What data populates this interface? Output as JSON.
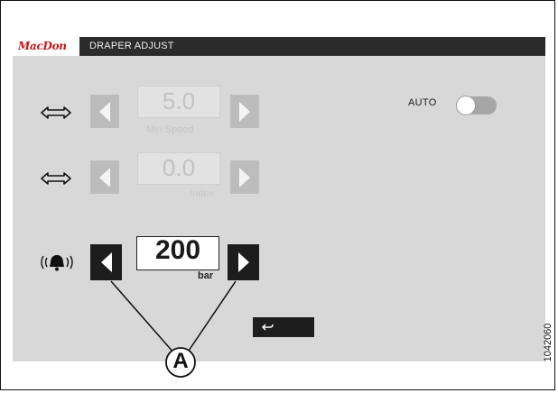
{
  "header": {
    "logo_text": "MacDon",
    "title": "DRAPER ADJUST"
  },
  "rows": [
    {
      "icon": "draper-speed-icon",
      "value": "5.0",
      "unit": "Min Speed",
      "state": "disabled"
    },
    {
      "icon": "draper-speed-icon",
      "value": "0.0",
      "unit": "Index",
      "state": "disabled"
    },
    {
      "icon": "alarm-bell-icon",
      "value": "200",
      "unit": "bar",
      "state": "active"
    }
  ],
  "auto": {
    "label": "AUTO",
    "enabled": false
  },
  "footer": {
    "back_icon": "back-arrow-icon"
  },
  "annotation": {
    "callout_letter": "A",
    "figure_number": "1042060"
  },
  "colors": {
    "brand_red": "#c4161c",
    "titlebar": "#2b2b2b",
    "screen_bg": "#d8d8d8",
    "button_dark": "#1d1d1d"
  }
}
